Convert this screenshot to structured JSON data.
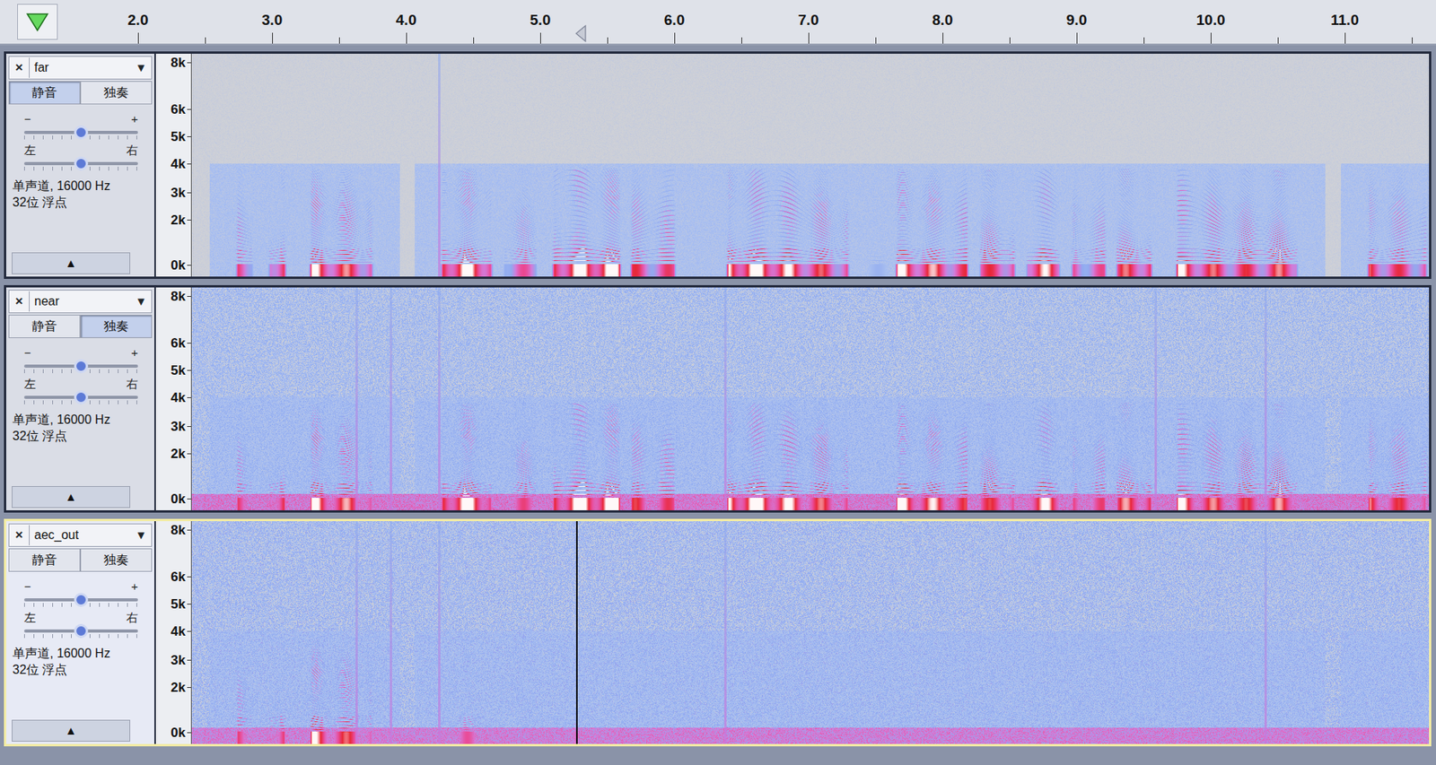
{
  "ruler": {
    "ticks": [
      {
        "label": "2.0",
        "time": 2.0
      },
      {
        "label": "3.0",
        "time": 3.0
      },
      {
        "label": "4.0",
        "time": 4.0
      },
      {
        "label": "5.0",
        "time": 5.0
      },
      {
        "label": "6.0",
        "time": 6.0
      },
      {
        "label": "7.0",
        "time": 7.0
      },
      {
        "label": "8.0",
        "time": 8.0
      },
      {
        "label": "9.0",
        "time": 9.0
      },
      {
        "label": "10.0",
        "time": 10.0
      },
      {
        "label": "11.0",
        "time": 11.0
      }
    ]
  },
  "cursor": {
    "time": 5.27
  },
  "tracks": [
    {
      "name": "far",
      "selected": false,
      "close": "×",
      "menu": "▼",
      "mute": {
        "label": "静音",
        "on": true
      },
      "solo": {
        "label": "独奏",
        "on": false
      },
      "gain": {
        "minus": "−",
        "plus": "+",
        "level": 0.5
      },
      "pan": {
        "left": "左",
        "right": "右",
        "level": 0.5
      },
      "info": [
        "单声道, 16000 Hz",
        "32位 浮点"
      ],
      "collapse": "▲",
      "scale": [
        {
          "label": "8k",
          "hz": 8000
        },
        {
          "label": "6k",
          "hz": 6000
        },
        {
          "label": "5k",
          "hz": 5000
        },
        {
          "label": "4k",
          "hz": 4000
        },
        {
          "label": "3k",
          "hz": 3000
        },
        {
          "label": "2k",
          "hz": 2000
        },
        {
          "label": "0k",
          "hz": 0
        }
      ],
      "noise": 0.14,
      "low_hum": 0.0,
      "bandwidth_hz": 4000,
      "segments": [
        {
          "start": 2.71,
          "end": 2.88,
          "level": 0.9
        },
        {
          "start": 2.95,
          "end": 3.12,
          "level": 0.85
        },
        {
          "start": 3.26,
          "end": 3.77,
          "level": 0.95
        },
        {
          "start": 4.24,
          "end": 4.66,
          "level": 0.92
        },
        {
          "start": 4.7,
          "end": 5.0,
          "level": 0.8
        },
        {
          "start": 5.07,
          "end": 5.62,
          "level": 0.95
        },
        {
          "start": 5.65,
          "end": 6.03,
          "level": 0.88
        },
        {
          "start": 6.37,
          "end": 7.32,
          "level": 0.95
        },
        {
          "start": 7.39,
          "end": 7.63,
          "level": 0.35
        },
        {
          "start": 7.63,
          "end": 8.21,
          "level": 0.9
        },
        {
          "start": 8.25,
          "end": 8.56,
          "level": 0.88
        },
        {
          "start": 8.6,
          "end": 8.9,
          "level": 0.85
        },
        {
          "start": 8.94,
          "end": 9.24,
          "level": 0.82
        },
        {
          "start": 9.27,
          "end": 9.58,
          "level": 0.85
        },
        {
          "start": 9.72,
          "end": 10.67,
          "level": 0.95
        },
        {
          "start": 11.15,
          "end": 11.63,
          "level": 0.9
        }
      ],
      "clicks": [
        4.24
      ]
    },
    {
      "name": "near",
      "selected": false,
      "close": "×",
      "menu": "▼",
      "mute": {
        "label": "静音",
        "on": false
      },
      "solo": {
        "label": "独奏",
        "on": true
      },
      "gain": {
        "minus": "−",
        "plus": "+",
        "level": 0.5
      },
      "pan": {
        "left": "左",
        "right": "右",
        "level": 0.5
      },
      "info": [
        "单声道, 16000 Hz",
        "32位 浮点"
      ],
      "collapse": "▲",
      "scale": [
        {
          "label": "8k",
          "hz": 8000
        },
        {
          "label": "6k",
          "hz": 6000
        },
        {
          "label": "5k",
          "hz": 5000
        },
        {
          "label": "4k",
          "hz": 4000
        },
        {
          "label": "3k",
          "hz": 3000
        },
        {
          "label": "2k",
          "hz": 2000
        },
        {
          "label": "0k",
          "hz": 0
        }
      ],
      "noise": 0.3,
      "low_hum": 0.62,
      "bandwidth_hz": 4000,
      "segments": [
        {
          "start": 2.71,
          "end": 2.88,
          "level": 0.92
        },
        {
          "start": 2.95,
          "end": 3.12,
          "level": 0.88
        },
        {
          "start": 3.26,
          "end": 3.77,
          "level": 0.97
        },
        {
          "start": 4.24,
          "end": 4.66,
          "level": 0.94
        },
        {
          "start": 4.7,
          "end": 5.0,
          "level": 0.84
        },
        {
          "start": 5.07,
          "end": 5.62,
          "level": 0.97
        },
        {
          "start": 5.65,
          "end": 6.03,
          "level": 0.9
        },
        {
          "start": 6.37,
          "end": 7.32,
          "level": 0.97
        },
        {
          "start": 7.39,
          "end": 7.63,
          "level": 0.4
        },
        {
          "start": 7.63,
          "end": 8.21,
          "level": 0.93
        },
        {
          "start": 8.25,
          "end": 8.56,
          "level": 0.9
        },
        {
          "start": 8.6,
          "end": 8.9,
          "level": 0.88
        },
        {
          "start": 8.94,
          "end": 9.24,
          "level": 0.86
        },
        {
          "start": 9.27,
          "end": 9.58,
          "level": 0.88
        },
        {
          "start": 9.72,
          "end": 10.67,
          "level": 0.97
        },
        {
          "start": 11.15,
          "end": 11.63,
          "level": 0.93
        }
      ],
      "clicks": [
        3.62,
        3.88,
        4.24,
        6.37,
        9.58,
        10.4
      ]
    },
    {
      "name": "aec_out",
      "selected": true,
      "close": "×",
      "menu": "▼",
      "mute": {
        "label": "静音",
        "on": false
      },
      "solo": {
        "label": "独奏",
        "on": false
      },
      "gain": {
        "minus": "−",
        "plus": "+",
        "level": 0.5
      },
      "pan": {
        "left": "左",
        "right": "右",
        "level": 0.5
      },
      "info": [
        "单声道, 16000 Hz",
        "32位 浮点"
      ],
      "collapse": "▲",
      "scale": [
        {
          "label": "8k",
          "hz": 8000
        },
        {
          "label": "6k",
          "hz": 6000
        },
        {
          "label": "5k",
          "hz": 5000
        },
        {
          "label": "4k",
          "hz": 4000
        },
        {
          "label": "3k",
          "hz": 3000
        },
        {
          "label": "2k",
          "hz": 2000
        },
        {
          "label": "0k",
          "hz": 0
        }
      ],
      "noise": 0.32,
      "low_hum": 0.6,
      "bandwidth_hz": 4000,
      "segments": [
        {
          "start": 2.71,
          "end": 2.88,
          "level": 0.9
        },
        {
          "start": 2.95,
          "end": 3.12,
          "level": 0.82
        },
        {
          "start": 3.26,
          "end": 3.77,
          "level": 0.92
        },
        {
          "start": 4.24,
          "end": 4.66,
          "level": 0.6
        },
        {
          "start": 4.7,
          "end": 5.0,
          "level": 0.5
        },
        {
          "start": 5.07,
          "end": 5.3,
          "level": 0.55
        },
        {
          "start": 5.3,
          "end": 5.62,
          "level": 0.4
        },
        {
          "start": 5.65,
          "end": 6.03,
          "level": 0.38
        },
        {
          "start": 6.37,
          "end": 7.32,
          "level": 0.42
        },
        {
          "start": 7.63,
          "end": 8.21,
          "level": 0.4
        },
        {
          "start": 8.25,
          "end": 8.56,
          "level": 0.38
        },
        {
          "start": 8.6,
          "end": 8.9,
          "level": 0.36
        },
        {
          "start": 8.94,
          "end": 9.24,
          "level": 0.38
        },
        {
          "start": 9.27,
          "end": 9.58,
          "level": 0.35
        },
        {
          "start": 9.72,
          "end": 10.67,
          "level": 0.42
        },
        {
          "start": 11.15,
          "end": 11.63,
          "level": 0.4
        }
      ],
      "clicks": [
        3.62,
        3.88,
        4.24,
        6.37,
        10.4
      ]
    }
  ]
}
